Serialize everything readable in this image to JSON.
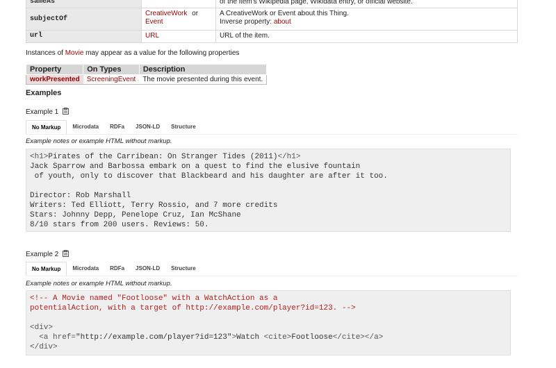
{
  "top_table": {
    "row_a": {
      "prop": "sameAs",
      "desc": "of the item's Wikipedia page, Wikidata entry, or official website."
    },
    "row_b": {
      "prop": "subjectOf",
      "type1": "CreativeWork",
      "or": "or",
      "type2": "Event",
      "desc1": "A CreativeWork or Event about this Thing.",
      "desc2_prefix": "Inverse property: ",
      "desc2_link": "about"
    },
    "row_c": {
      "prop": "url",
      "type": "URL",
      "desc": "URL of the item."
    }
  },
  "instances": {
    "prefix": "Instances of ",
    "link": "Movie",
    "suffix": " may appear as a value for the following properties"
  },
  "wp_table": {
    "headers": [
      "Property",
      "On Types",
      "Description"
    ],
    "row": {
      "prop": "workPresented",
      "type": "ScreeningEvent",
      "desc": "The movie presented during this event."
    }
  },
  "examples_heading": "Examples",
  "tabs": [
    "No Markup",
    "Microdata",
    "RDFa",
    "JSON-LD",
    "Structure"
  ],
  "example1": {
    "title": "Example 1",
    "notes": "Example notes or example HTML without markup.",
    "code": {
      "l1_open": "<h1>",
      "l1_text": "Pirates of the Carribean: On Stranger Tides (2011)",
      "l1_close": "</h1>",
      "l2": "Jack Sparrow and Barbossa embark on a quest to find the elusive fountain",
      "l3": " of youth, only to discover that Blackbeard and his daughter are after it too.",
      "l5": "Director: Rob Marshall",
      "l6": "Writers: Ted Elliott, Terry Rossio, and 7 more credits",
      "l7": "Stars: Johnny Depp, Penelope Cruz, Ian McShane",
      "l8": "8/10 stars from 200 users. Reviews: 50."
    }
  },
  "example2": {
    "title": "Example 2",
    "notes": "Example notes or example HTML without markup.",
    "code": {
      "c1": "<!-- A Movie named \"Footloose\" with a WatchAction as a",
      "c2": "potentialAction, with a target of http://example.com/player?id=123. -->",
      "div_open": "<div>",
      "a_open": "  <a href=",
      "a_href": "\"http://example.com/player?id=123\"",
      "a_gt": ">",
      "a_text": "Watch ",
      "cite_open": "<cite>",
      "cite_text": "Footloose",
      "cite_close": "</cite>",
      "a_close": "</a>",
      "div_close": "</div>"
    }
  },
  "colors": {
    "link": "#990000",
    "code_bg": "#efefef",
    "header_bg": "#d6d6d6"
  },
  "icons": {
    "copy": "clipboard-icon"
  }
}
